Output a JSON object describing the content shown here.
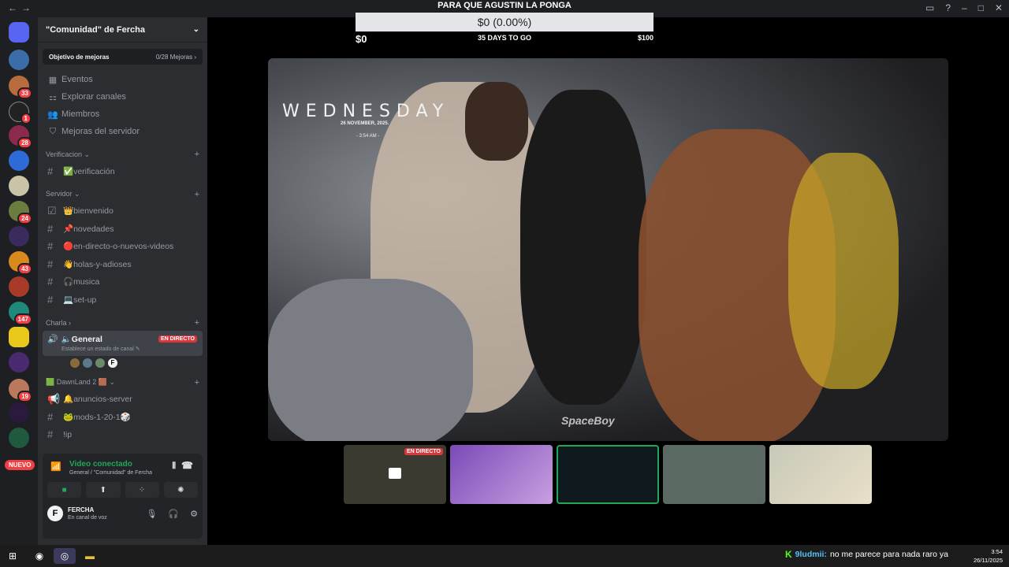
{
  "window": {
    "back": "←",
    "forward": "→"
  },
  "server": {
    "name": "\"Comunidad\" de Fercha",
    "chevron": "⌄"
  },
  "boost": {
    "label": "Objetivo de mejoras",
    "progress": "0/28 Mejoras ›"
  },
  "menu": [
    {
      "icon": "▦",
      "label": "Eventos"
    },
    {
      "icon": "⚏",
      "label": "Explorar canales"
    },
    {
      "icon": "👥",
      "label": "Miembros"
    },
    {
      "icon": "⛉",
      "label": "Mejoras del servidor"
    }
  ],
  "categories": {
    "verificacion": "Verificacion ⌄",
    "servidor": "Servidor ⌄",
    "charla": "Charla ›",
    "dawnland": "🟩 DawnLand 2 🟫 ⌄"
  },
  "channels": {
    "verificacion": [
      "✅verificación"
    ],
    "servidor": [
      "👑bienvenido",
      "📌novedades",
      "🔴en-directo-o-nuevos-videos",
      "👋holas-y-adioses",
      "🎧musica",
      "💻set-up"
    ],
    "dawnland": [
      "🔔anuncios-server",
      "🐸mods-1-20-1🎲",
      "!ip"
    ]
  },
  "voice": {
    "channel": "🔈General",
    "live": "EN DIRECTO",
    "status": "Establece un estado de canal ✎",
    "user_initial": "F"
  },
  "guild_badges": [
    "33",
    "1",
    "28",
    "24",
    "43",
    "147",
    "19"
  ],
  "nuevo": "NUEVO",
  "panel": {
    "connected": "Video conectado",
    "location": "General / \"Comunidad\" de Fercha",
    "user": "FERCHA",
    "user_status": "En canal de voz",
    "initial": "F"
  },
  "stream_goal": {
    "title": "PARA QUE AGUSTIN LA PONGA",
    "amount": "$0 (0.00%)",
    "min": "$0",
    "days": "35 DAYS TO GO",
    "max": "$100",
    "progress": 0
  },
  "video": {
    "wednesday": "WEDNESDAY",
    "date": "26 NOVEMBER, 2025.",
    "time": "- 3:54 AM -",
    "watermark": "SpaceBoy"
  },
  "thumbs": {
    "live": "EN DIRECTO"
  },
  "taskbar": {
    "chat_user": "9ludmii:",
    "chat_text": "no me parece para nada raro ya",
    "kick": "K",
    "time": "3:54",
    "date": "26/11/2025"
  },
  "colors": {
    "accent": "#5865f2",
    "live": "#da373c",
    "green": "#23a55a"
  }
}
